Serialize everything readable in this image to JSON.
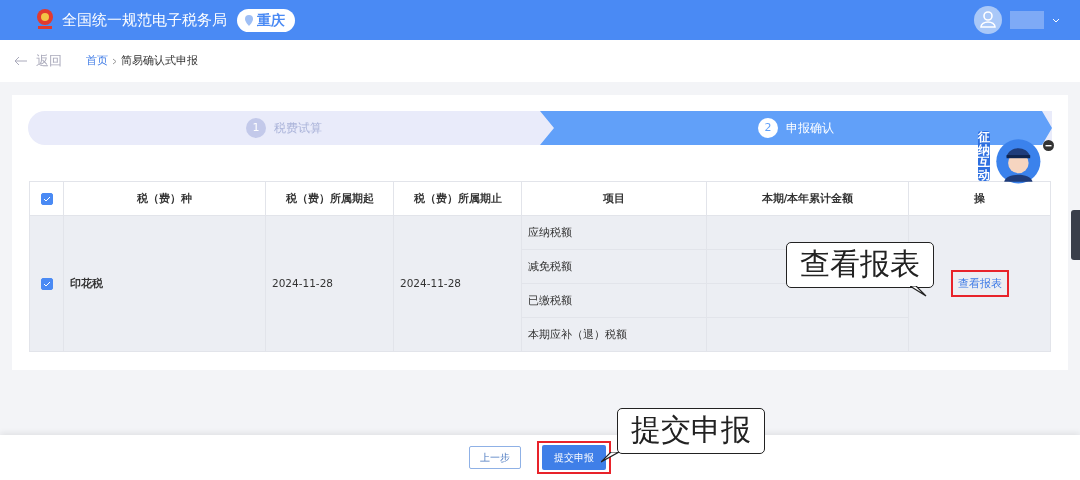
{
  "header": {
    "title": "全国统一规范电子税务局",
    "location": "重庆"
  },
  "breadcrumb": {
    "back": "返回",
    "home": "首页",
    "current": "简易确认式申报"
  },
  "steps": [
    {
      "number": "1",
      "label": "税费试算",
      "selected": false
    },
    {
      "number": "2",
      "label": "申报确认",
      "selected": true
    }
  ],
  "table": {
    "select_all": {
      "checked": true
    },
    "columns": [
      "税（费）种",
      "税（费）所属期起",
      "税（费）所属期止",
      "项目",
      "本期/本年累计金额",
      "操"
    ],
    "rows": [
      {
        "checked": true,
        "tax": "印花税",
        "period_start": "2024-11-28",
        "period_end": "2024-11-28",
        "items": [
          "应纳税额",
          "减免税额",
          "已缴税额",
          "本期应补（退）税额"
        ],
        "action": "查看报表"
      }
    ]
  },
  "mascot": {
    "text": "征纳互动"
  },
  "callouts": [
    "查看报表",
    "提交申报"
  ],
  "footer": {
    "buttons": [
      {
        "label": "上一步",
        "kind": "secondary"
      },
      {
        "label": "提交申报",
        "kind": "primary"
      }
    ]
  }
}
